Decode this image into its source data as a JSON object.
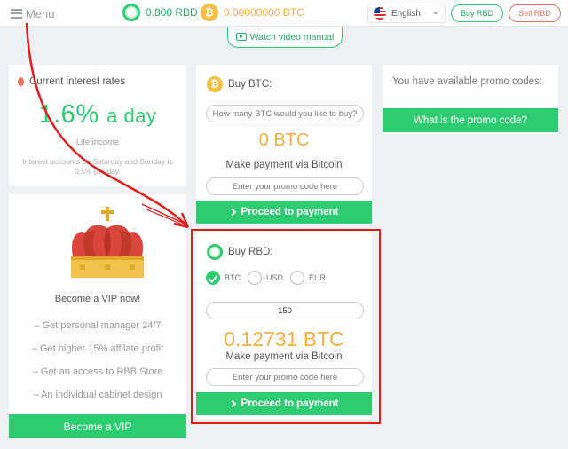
{
  "header": {
    "menu_label": "Menu",
    "rbd_balance": "0.800 RBD",
    "btc_balance": "0.00000000 BTC",
    "btc_symbol": "₿",
    "language": "English",
    "buy_label": "Buy RBD",
    "sell_label": "Sell RBD"
  },
  "video": {
    "label": "Watch video manual"
  },
  "interest": {
    "title": "Current interest rates",
    "rate": "1.6%",
    "rate_unit": "a day",
    "sub": "Life income",
    "note": "Interest accounts on Saturday and Sunday is 0.5% per day."
  },
  "vip": {
    "title": "Become a VIP now!",
    "items": [
      "– Get personal manager 24/7",
      "– Get higher 15% affilate profit",
      "– Get an access to RBB Store",
      "– An individual cabinet design"
    ],
    "button": "Become a VIP"
  },
  "buy_btc": {
    "title": "Buy BTC:",
    "amount_placeholder": "How many BTC would you like to buy?",
    "amount": "0 BTC",
    "pay_text": "Make payment via Bitcoin",
    "promo_placeholder": "Enter your promo code here",
    "button": "Proceed to payment"
  },
  "buy_rbd": {
    "title": "Buy RBD:",
    "currencies": [
      "BTC",
      "USD",
      "EUR"
    ],
    "selected": "BTC",
    "quantity": "150",
    "amount": "0.12731 BTC",
    "pay_text": "Make payment via Bitcoin",
    "promo_placeholder": "Enter your promo code here",
    "button": "Proceed to payment"
  },
  "promo": {
    "text": "You have available promo codes:",
    "button": "What is the promo code?"
  },
  "colors": {
    "accent": "#2ecc71",
    "btc": "#f5b041",
    "sell": "#e8735a",
    "highlight": "#e21b1b"
  }
}
